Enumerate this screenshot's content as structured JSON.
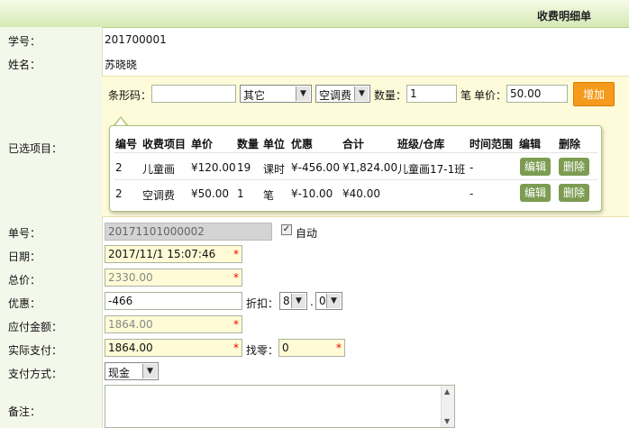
{
  "header": {
    "title": "收费明细单"
  },
  "fields": {
    "student_id_label": "学号：",
    "student_id": "201700001",
    "name_label": "姓名：",
    "name": "苏晓晓",
    "selected_label": "已选项目：",
    "order_no_label": "单号：",
    "order_no": "20171101000002",
    "auto_label": "自动",
    "date_label": "日期：",
    "date": "2017/11/1 15:07:46",
    "total_label": "总价：",
    "total": "2330.00",
    "discount_label": "优惠：",
    "discount": "-466",
    "rate_label": "折扣：",
    "rate_int": "8",
    "rate_dec": "0",
    "payable_label": "应付金额：",
    "payable": "1864.00",
    "paid_label": "实际支付：",
    "paid": "1864.00",
    "change_label": "找零：",
    "change": "0",
    "method_label": "支付方式：",
    "method": "现金",
    "note_label": "备注："
  },
  "barbar": {
    "barcode_label": "条形码：",
    "barcode": "",
    "category": "其它",
    "item": "空调费",
    "qty_label": "数量：",
    "qty": "1",
    "unit": "笔",
    "price_label": "单价：",
    "price": "50.00",
    "add_label": "增加"
  },
  "table": {
    "headers": [
      "编号",
      "收费项目",
      "单价",
      "数量",
      "单位",
      "优惠",
      "合计",
      "班级/仓库",
      "时间范围",
      "编辑",
      "删除"
    ],
    "rows": [
      [
        "2",
        "儿童画",
        "¥120.00",
        "19",
        "课时",
        "¥-456.00",
        "¥1,824.00",
        "儿童画17-1班",
        "-"
      ],
      [
        "2",
        "空调费",
        "¥50.00",
        "1",
        "笔",
        "¥-10.00",
        "¥40.00",
        "",
        "-"
      ]
    ],
    "edit_label": "编辑",
    "delete_label": "删除"
  },
  "required_mark": "*",
  "colors": {
    "accent_orange": "#f59a1a",
    "button_green": "#7d9c52",
    "header_green": "#d6e9b4"
  }
}
